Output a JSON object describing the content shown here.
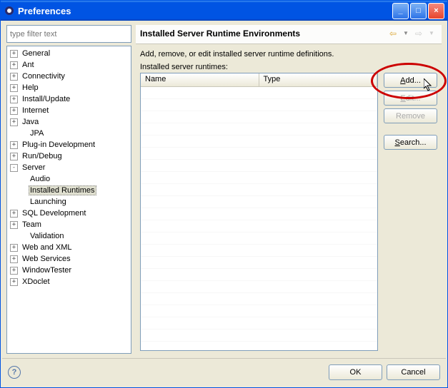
{
  "window_title": "Preferences",
  "filter_placeholder": "type filter text",
  "tree": [
    {
      "exp": "+",
      "lvl": 0,
      "label": "General"
    },
    {
      "exp": "+",
      "lvl": 0,
      "label": "Ant"
    },
    {
      "exp": "+",
      "lvl": 0,
      "label": "Connectivity"
    },
    {
      "exp": "+",
      "lvl": 0,
      "label": "Help"
    },
    {
      "exp": "+",
      "lvl": 0,
      "label": "Install/Update"
    },
    {
      "exp": "+",
      "lvl": 0,
      "label": "Internet"
    },
    {
      "exp": "+",
      "lvl": 0,
      "label": "Java"
    },
    {
      "exp": "",
      "lvl": 1,
      "label": "JPA"
    },
    {
      "exp": "+",
      "lvl": 0,
      "label": "Plug-in Development"
    },
    {
      "exp": "+",
      "lvl": 0,
      "label": "Run/Debug"
    },
    {
      "exp": "-",
      "lvl": 0,
      "label": "Server"
    },
    {
      "exp": "",
      "lvl": 1,
      "label": "Audio"
    },
    {
      "exp": "",
      "lvl": 1,
      "label": "Installed Runtimes",
      "sel": true
    },
    {
      "exp": "",
      "lvl": 1,
      "label": "Launching"
    },
    {
      "exp": "+",
      "lvl": 0,
      "label": "SQL Development"
    },
    {
      "exp": "+",
      "lvl": 0,
      "label": "Team"
    },
    {
      "exp": "",
      "lvl": 1,
      "label": "Validation"
    },
    {
      "exp": "+",
      "lvl": 0,
      "label": "Web and XML"
    },
    {
      "exp": "+",
      "lvl": 0,
      "label": "Web Services"
    },
    {
      "exp": "+",
      "lvl": 0,
      "label": "WindowTester"
    },
    {
      "exp": "+",
      "lvl": 0,
      "label": "XDoclet"
    }
  ],
  "page": {
    "title": "Installed Server Runtime Environments",
    "desc": "Add, remove, or edit installed server runtime definitions.",
    "list_label": "Installed server runtimes:",
    "col_name": "Name",
    "col_type": "Type",
    "btn_add": "Add...",
    "btn_edit": "Edit...",
    "btn_remove": "Remove",
    "btn_search": "Search..."
  },
  "footer": {
    "ok": "OK",
    "cancel": "Cancel"
  }
}
